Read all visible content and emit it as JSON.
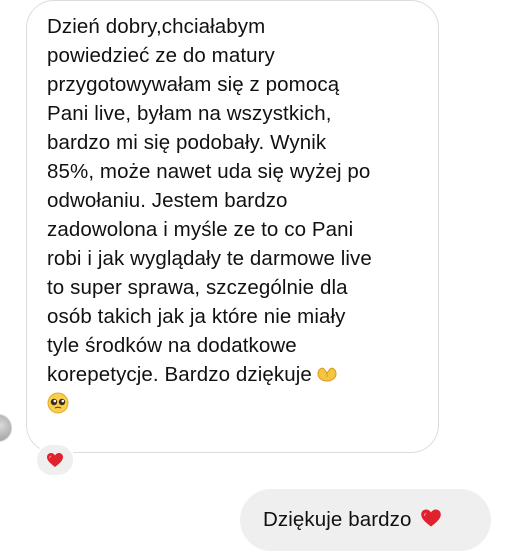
{
  "conversation": {
    "incoming": {
      "text": "Dzień dobry,chciałabym\npowiedzieć ze do matury\nprzygotowywałam się z pomocą\nPani live, byłam na wszystkich,\nbardzo mi się podobały. Wynik\n85%, może nawet uda się wyżej po\nodwołaniu. Jestem bardzo\nzadowolona i myśle ze to co Pani\nrobi i jak wyglądały te darmowe live\nto super sprawa, szczególnie dla\nosób takich jak ja które nie miały\ntyle środków na dodatkowe\nkorepetycje. Bardzo dziękuje",
      "emojis": [
        "heart-hands-icon",
        "pleading-face-icon"
      ],
      "reaction": "red-heart-icon"
    },
    "outgoing": {
      "text": "Dziękuje bardzo",
      "emoji": "red-heart-icon"
    }
  },
  "colors": {
    "incoming_border": "#dcdcdc",
    "outgoing_bubble": "#efefef",
    "reaction_bg": "#efefef",
    "heart": "#e0212e",
    "text": "#111111"
  }
}
